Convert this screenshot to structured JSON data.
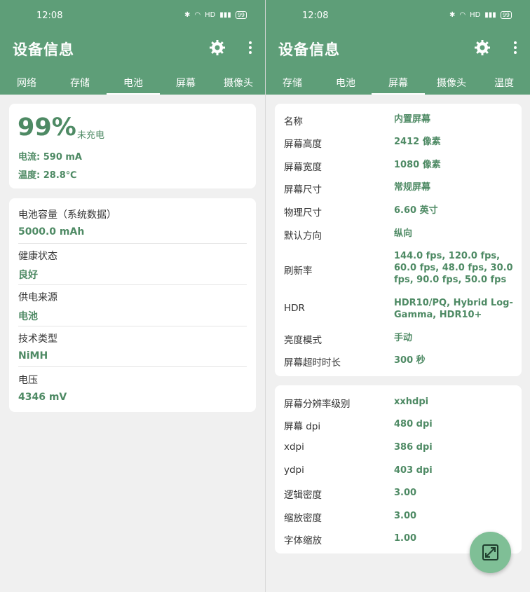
{
  "left": {
    "status": {
      "time": "12:08",
      "battery": "99"
    },
    "title": "设备信息",
    "tabs": [
      "网络",
      "存储",
      "电池",
      "屏幕",
      "摄像头"
    ],
    "battery_card": {
      "percent": "99%",
      "charge_state": "未充电",
      "current": "电流: 590 mA",
      "temperature": "温度: 28.8℃"
    },
    "details": [
      {
        "label": "电池容量（系统数据）",
        "value": "5000.0 mAh"
      },
      {
        "label": "健康状态",
        "value": "良好"
      },
      {
        "label": "供电来源",
        "value": "电池"
      },
      {
        "label": "技术类型",
        "value": "NiMH"
      },
      {
        "label": "电压",
        "value": "4346 mV"
      }
    ]
  },
  "right": {
    "status": {
      "time": "12:08",
      "battery": "99"
    },
    "title": "设备信息",
    "tabs": [
      "存储",
      "电池",
      "屏幕",
      "摄像头",
      "温度"
    ],
    "screen": [
      {
        "label": "名称",
        "value": "内置屏幕"
      },
      {
        "label": "屏幕高度",
        "value": "2412 像素"
      },
      {
        "label": "屏幕宽度",
        "value": "1080 像素"
      },
      {
        "label": "屏幕尺寸",
        "value": "常规屏幕"
      },
      {
        "label": "物理尺寸",
        "value": "6.60  英寸"
      },
      {
        "label": "默认方向",
        "value": "纵向"
      },
      {
        "label": "刷新率",
        "value": "144.0 fps, 120.0 fps, 60.0 fps, 48.0 fps, 30.0 fps, 90.0 fps, 50.0 fps"
      },
      {
        "label": "HDR",
        "value": "HDR10/PQ, Hybrid Log-Gamma, HDR10+"
      },
      {
        "label": "亮度模式",
        "value": "手动"
      },
      {
        "label": "屏幕超时时长",
        "value": "300 秒"
      }
    ],
    "density": [
      {
        "label": "屏幕分辨率级别",
        "value": "xxhdpi"
      },
      {
        "label": "屏幕 dpi",
        "value": "480 dpi"
      },
      {
        "label": "xdpi",
        "value": "386 dpi"
      },
      {
        "label": "ydpi",
        "value": "403 dpi"
      },
      {
        "label": "逻辑密度",
        "value": "3.00"
      },
      {
        "label": "缩放密度",
        "value": "3.00"
      },
      {
        "label": "字体缩放",
        "value": "1.00"
      }
    ]
  },
  "icons": [
    "bluetooth-icon",
    "wifi-icon",
    "hd-icon",
    "signal-icon",
    "battery-icon",
    "gear-icon",
    "more-vert-icon",
    "expand-icon"
  ],
  "colors": {
    "accent": "#5e9e78",
    "value_green": "#4e8a64",
    "fab": "#7fbf96"
  }
}
